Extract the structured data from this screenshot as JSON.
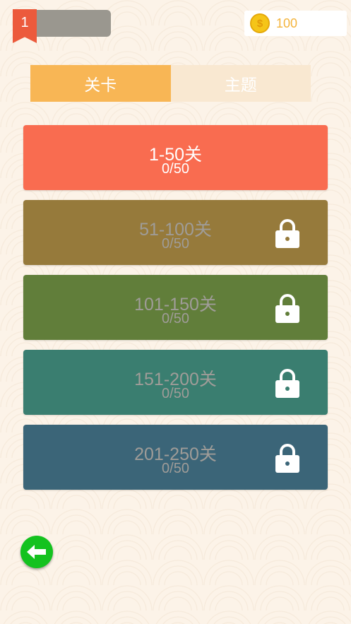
{
  "header": {
    "level": "1",
    "coins": "100",
    "coin_symbol": "$"
  },
  "tabs": [
    {
      "label": "关卡",
      "active": true
    },
    {
      "label": "主题",
      "active": false
    }
  ],
  "levels": [
    {
      "title": "1-50关",
      "progress": "0/50",
      "color": "#f96c50",
      "locked": false
    },
    {
      "title": "51-100关",
      "progress": "0/50",
      "color": "#967a3b",
      "locked": true
    },
    {
      "title": "101-150关",
      "progress": "0/50",
      "color": "#617e3a",
      "locked": true
    },
    {
      "title": "151-200关",
      "progress": "0/50",
      "color": "#3a7e70",
      "locked": true
    },
    {
      "title": "201-250关",
      "progress": "0/50",
      "color": "#3b6578",
      "locked": true
    }
  ],
  "icons": {
    "back": "back-arrow-icon",
    "lock": "lock-icon",
    "coin": "coin-icon",
    "level": "bookmark-icon"
  },
  "colors": {
    "tab_active": "#f8b655",
    "tab_inactive": "#f9e8d1",
    "coin_text": "#f4b43c",
    "back_button": "#14c21f",
    "badge": "#ec5a3c"
  }
}
